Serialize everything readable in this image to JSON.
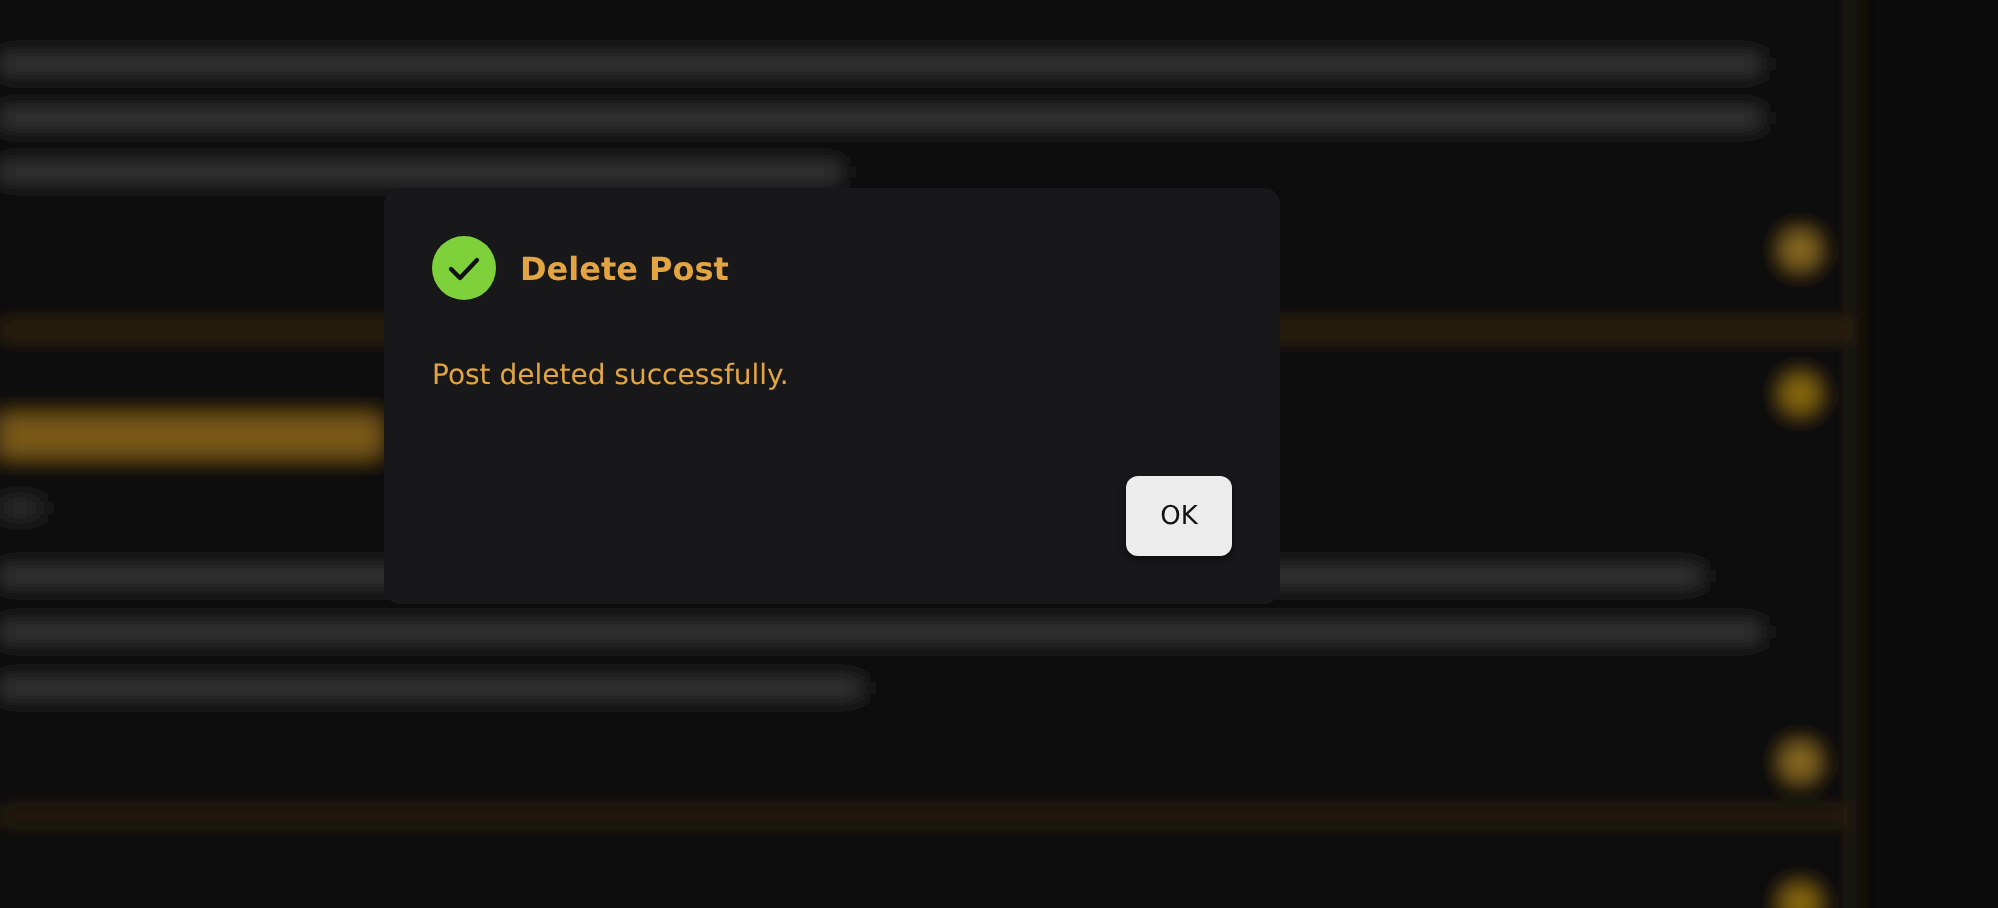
{
  "dialog": {
    "title": "Delete Post",
    "success": true,
    "message": "Post deleted successfully.",
    "buttons": [
      "OK"
    ]
  }
}
